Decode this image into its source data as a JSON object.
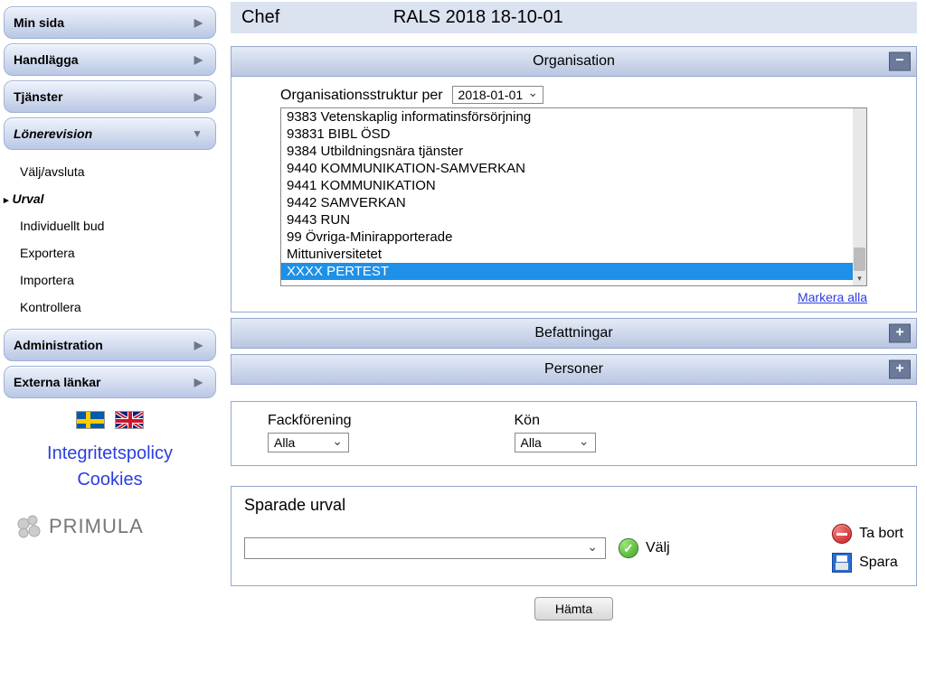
{
  "sidebar": {
    "items": [
      {
        "label": "Min sida",
        "expandable": true
      },
      {
        "label": "Handlägga",
        "expandable": true
      },
      {
        "label": "Tjänster",
        "expandable": true
      },
      {
        "label": "Lönerevision",
        "expandable": true,
        "open": true,
        "children": [
          {
            "label": "Välj/avsluta"
          },
          {
            "label": "Urval",
            "active": true
          },
          {
            "label": "Individuellt bud"
          },
          {
            "label": "Exportera"
          },
          {
            "label": "Importera"
          },
          {
            "label": "Kontrollera"
          }
        ]
      },
      {
        "label": "Administration",
        "expandable": true
      },
      {
        "label": "Externa länkar",
        "expandable": true
      }
    ],
    "policy": [
      "Integritetspolicy",
      "Cookies"
    ],
    "logo": "PRIMULA"
  },
  "header": {
    "role": "Chef",
    "title": "RALS 2018 18-10-01"
  },
  "panels": {
    "organisation": {
      "heading": "Organisation",
      "toggle": "−",
      "struct_label": "Organisationsstruktur per",
      "struct_date": "2018-01-01",
      "list": [
        "9383 Vetenskaplig informatinsförsörjning",
        "93831 BIBL ÖSD",
        "9384 Utbildningsnära tjänster",
        "9440 KOMMUNIKATION-SAMVERKAN",
        "9441 KOMMUNIKATION",
        "9442 SAMVERKAN",
        "9443 RUN",
        "99 Övriga-Minirapporterade",
        "Mittuniversitetet",
        "XXXX PERTEST"
      ],
      "selected_index": 9,
      "mark_all": "Markera alla"
    },
    "befattningar": {
      "heading": "Befattningar",
      "toggle": "+"
    },
    "personer": {
      "heading": "Personer",
      "toggle": "+"
    }
  },
  "filters": {
    "fack_label": "Fackförening",
    "fack_value": "Alla",
    "kon_label": "Kön",
    "kon_value": "Alla"
  },
  "saved": {
    "heading": "Sparade urval",
    "valj": "Välj",
    "tabort": "Ta bort",
    "spara": "Spara"
  },
  "hamta": "Hämta"
}
